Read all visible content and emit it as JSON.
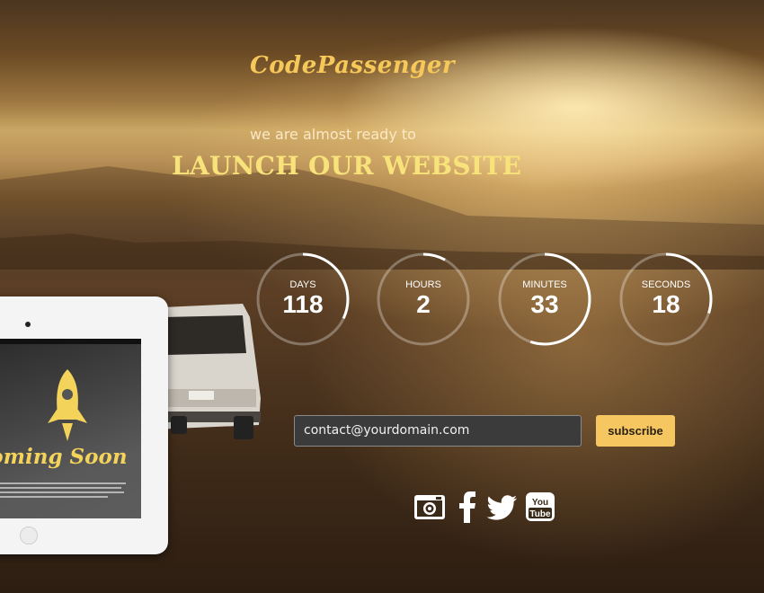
{
  "brand": {
    "logo": "CodePassenger"
  },
  "hero": {
    "tagline": "we are almost ready to",
    "headline": "LAUNCH OUR WEBSITE"
  },
  "countdown": [
    {
      "label": "DAYS",
      "value": "118",
      "progress": 0.32
    },
    {
      "label": "HOURS",
      "value": "2",
      "progress": 0.08
    },
    {
      "label": "MINUTES",
      "value": "33",
      "progress": 0.55
    },
    {
      "label": "SECONDS",
      "value": "18",
      "progress": 0.3
    }
  ],
  "subscribe": {
    "email_value": "contact@yourdomain.com",
    "button_label": "subscribe"
  },
  "social": [
    "camera-icon",
    "facebook-icon",
    "twitter-icon",
    "youtube-icon"
  ],
  "device_preview": {
    "screen_title": "Coming Soon"
  },
  "colors": {
    "brand": "#f6c85a",
    "headline": "#f8e27a",
    "button": "#f6c760"
  }
}
